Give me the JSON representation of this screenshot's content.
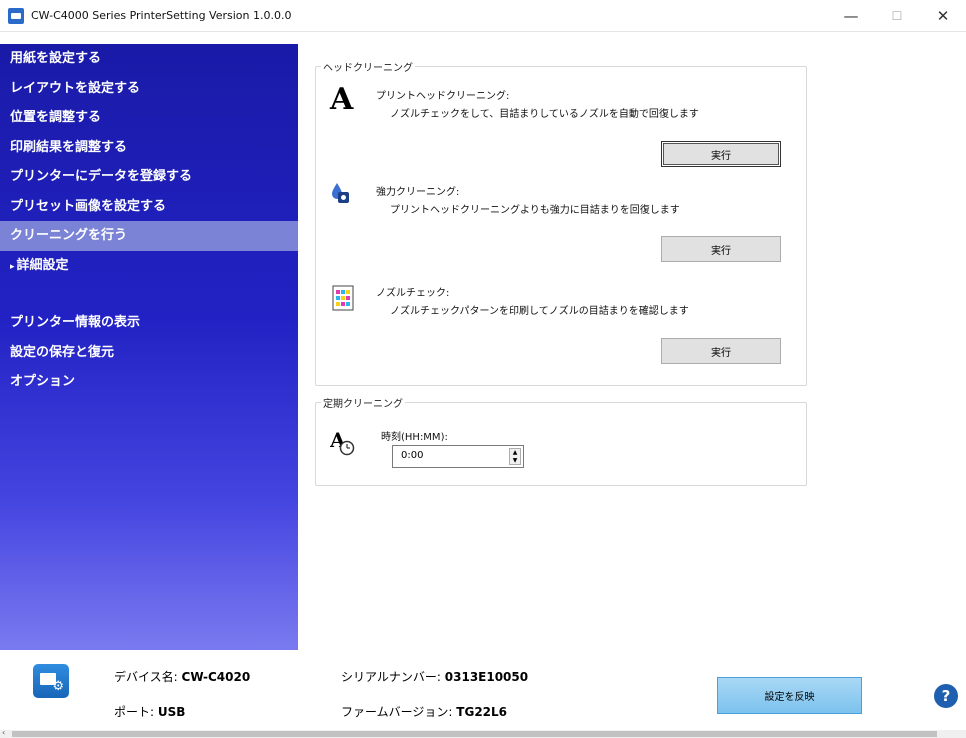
{
  "window": {
    "title": "CW-C4000 Series PrinterSetting Version 1.0.0.0",
    "minimize": "—",
    "maximize": "☐",
    "close": "✕"
  },
  "sidebar": {
    "items": [
      {
        "label": "用紙を設定する"
      },
      {
        "label": "レイアウトを設定する"
      },
      {
        "label": "位置を調整する"
      },
      {
        "label": "印刷結果を調整する"
      },
      {
        "label": "プリンターにデータを登録する"
      },
      {
        "label": "プリセット画像を設定する"
      },
      {
        "label": "クリーニングを行う",
        "active": true
      },
      {
        "label": "詳細設定",
        "arrow": "▸"
      }
    ],
    "lower_items": [
      {
        "label": "プリンター情報の表示"
      },
      {
        "label": "設定の保存と復元"
      },
      {
        "label": "オプション"
      }
    ]
  },
  "head_cleaning": {
    "group_label": "ヘッドクリーニング",
    "print_head": {
      "title": "プリントヘッドクリーニング:",
      "desc": "ノズルチェックをして、目詰まりしているノズルを自動で回復します",
      "button": "実行"
    },
    "power": {
      "title": "強力クリーニング:",
      "desc": "プリントヘッドクリーニングよりも強力に目詰まりを回復します",
      "button": "実行"
    },
    "nozzle": {
      "title": "ノズルチェック:",
      "desc": "ノズルチェックパターンを印刷してノズルの目詰まりを確認します",
      "button": "実行"
    }
  },
  "periodic_cleaning": {
    "group_label": "定期クリーニング",
    "time_label": "時刻(HH:MM):",
    "time_value": "0:00"
  },
  "footer": {
    "device_name_label": "デバイス名:",
    "device_name_value": "CW-C4020",
    "port_label": "ポート:",
    "port_value": "USB",
    "serial_label": "シリアルナンバー:",
    "serial_value": "0313E10050",
    "firmware_label": "ファームバージョン:",
    "firmware_value": "TG22L6",
    "apply_button": "設定を反映",
    "help": "?"
  },
  "colors": {
    "sidebar_top": "#1a1aa8",
    "sidebar_bottom": "#7a7af0",
    "sidebar_active": "#7b83d6",
    "apply_button": "#8ccaf0",
    "help_button": "#1e5fb0"
  }
}
